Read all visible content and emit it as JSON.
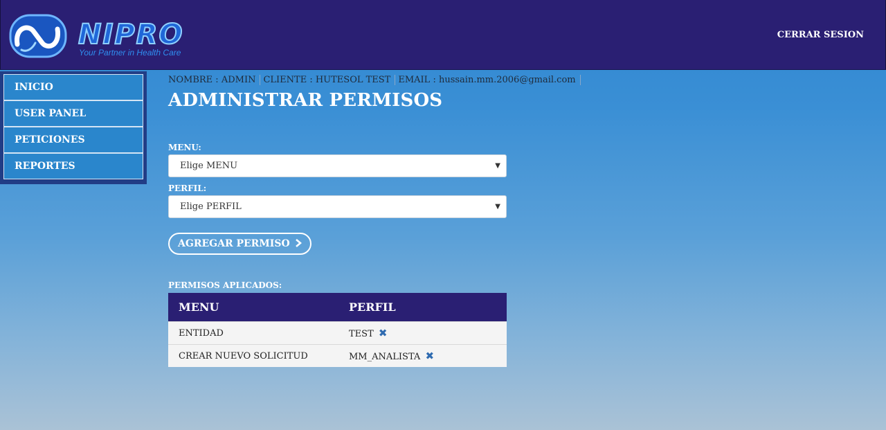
{
  "brand": {
    "name": "NIPRO",
    "tagline": "Your Partner in Health Care"
  },
  "header": {
    "logout_label": "CERRAR SESION"
  },
  "sidebar": {
    "items": [
      {
        "label": "INICIO"
      },
      {
        "label": "USER PANEL"
      },
      {
        "label": "PETICIONES"
      },
      {
        "label": "REPORTES"
      }
    ]
  },
  "user_info": {
    "name": "NOMBRE : ADMIN",
    "client": "CLIENTE : HUTESOL TEST",
    "email": "EMAIL : hussain.mm.2006@gmail.com"
  },
  "page": {
    "title": "ADMINISTRAR PERMISOS"
  },
  "form": {
    "menu_label": "MENU:",
    "menu_selected": "Elige MENU",
    "profile_label": "PERFIL:",
    "profile_selected": "Elige PERFIL",
    "add_button_label": "AGREGAR PERMISO"
  },
  "permissions": {
    "section_label": "PERMISOS APLICADOS:",
    "columns": [
      "MENU",
      "PERFIL"
    ],
    "rows": [
      {
        "menu": "ENTIDAD",
        "profile": "TEST"
      },
      {
        "menu": "CREAR NUEVO SOLICITUD",
        "profile": "MM_ANALISTA"
      }
    ]
  },
  "icons": {
    "remove": "close-icon",
    "add_arrow": "chevron-right-icon",
    "select_caret": "caret-down-icon"
  },
  "colors": {
    "header_bg": "#2a1f73",
    "nav_item_bg": "#2a86cc",
    "table_header_bg": "#2a1f73",
    "remove_icon": "#2f6bb0"
  }
}
